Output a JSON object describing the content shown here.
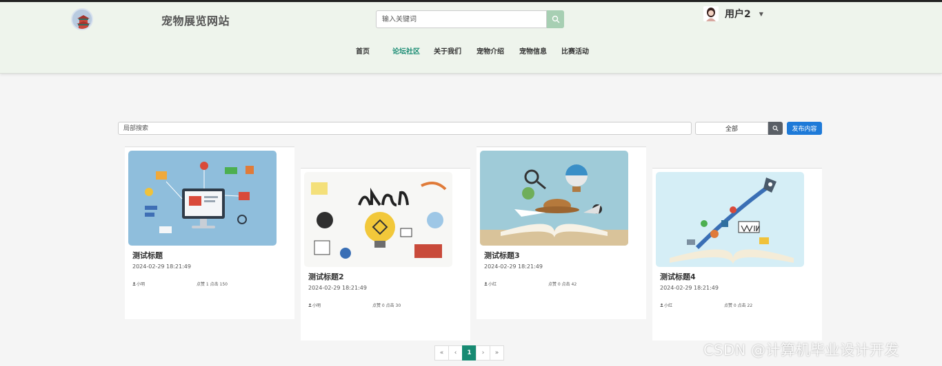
{
  "header": {
    "site_title": "宠物展览网站",
    "search_placeholder": "输入关键词",
    "user_name": "用户2"
  },
  "nav": [
    {
      "label": "首页"
    },
    {
      "label": "论坛社区",
      "active": true
    },
    {
      "label": "关于我们"
    },
    {
      "label": "宠物介绍"
    },
    {
      "label": "宠物信息"
    },
    {
      "label": "比赛活动"
    }
  ],
  "filter": {
    "placeholder": "局部搜索",
    "category": "全部",
    "publish_label": "发布内容"
  },
  "posts": [
    {
      "title": "测试标题",
      "date": "2024-02-29 18:21:49",
      "author": "小明",
      "stats": "点赞 1 点击 150",
      "image": "e-commerce-illustration"
    },
    {
      "title": "测试标题2",
      "date": "2024-02-29 18:21:49",
      "author": "小明",
      "stats": "点赞 0 点击 30",
      "image": "learn-lightbulb-illustration"
    },
    {
      "title": "测试标题3",
      "date": "2024-02-29 18:21:49",
      "author": "小红",
      "stats": "点赞 0 点击 42",
      "image": "travel-book-illustration"
    },
    {
      "title": "测试标题4",
      "date": "2024-02-29 18:21:49",
      "author": "小红",
      "stats": "点赞 0 点击 22",
      "image": "win-book-rocket-illustration"
    }
  ],
  "pagination": {
    "first": "«",
    "prev": "‹",
    "current": "1",
    "next": "›",
    "last": "»"
  },
  "watermark": "CSDN @计算机毕业设计开发",
  "colors": {
    "accent": "#178a72",
    "header_bg": "#eef4ec",
    "publish_button": "#1e7ad8",
    "search_button": "#a7cfb3"
  }
}
